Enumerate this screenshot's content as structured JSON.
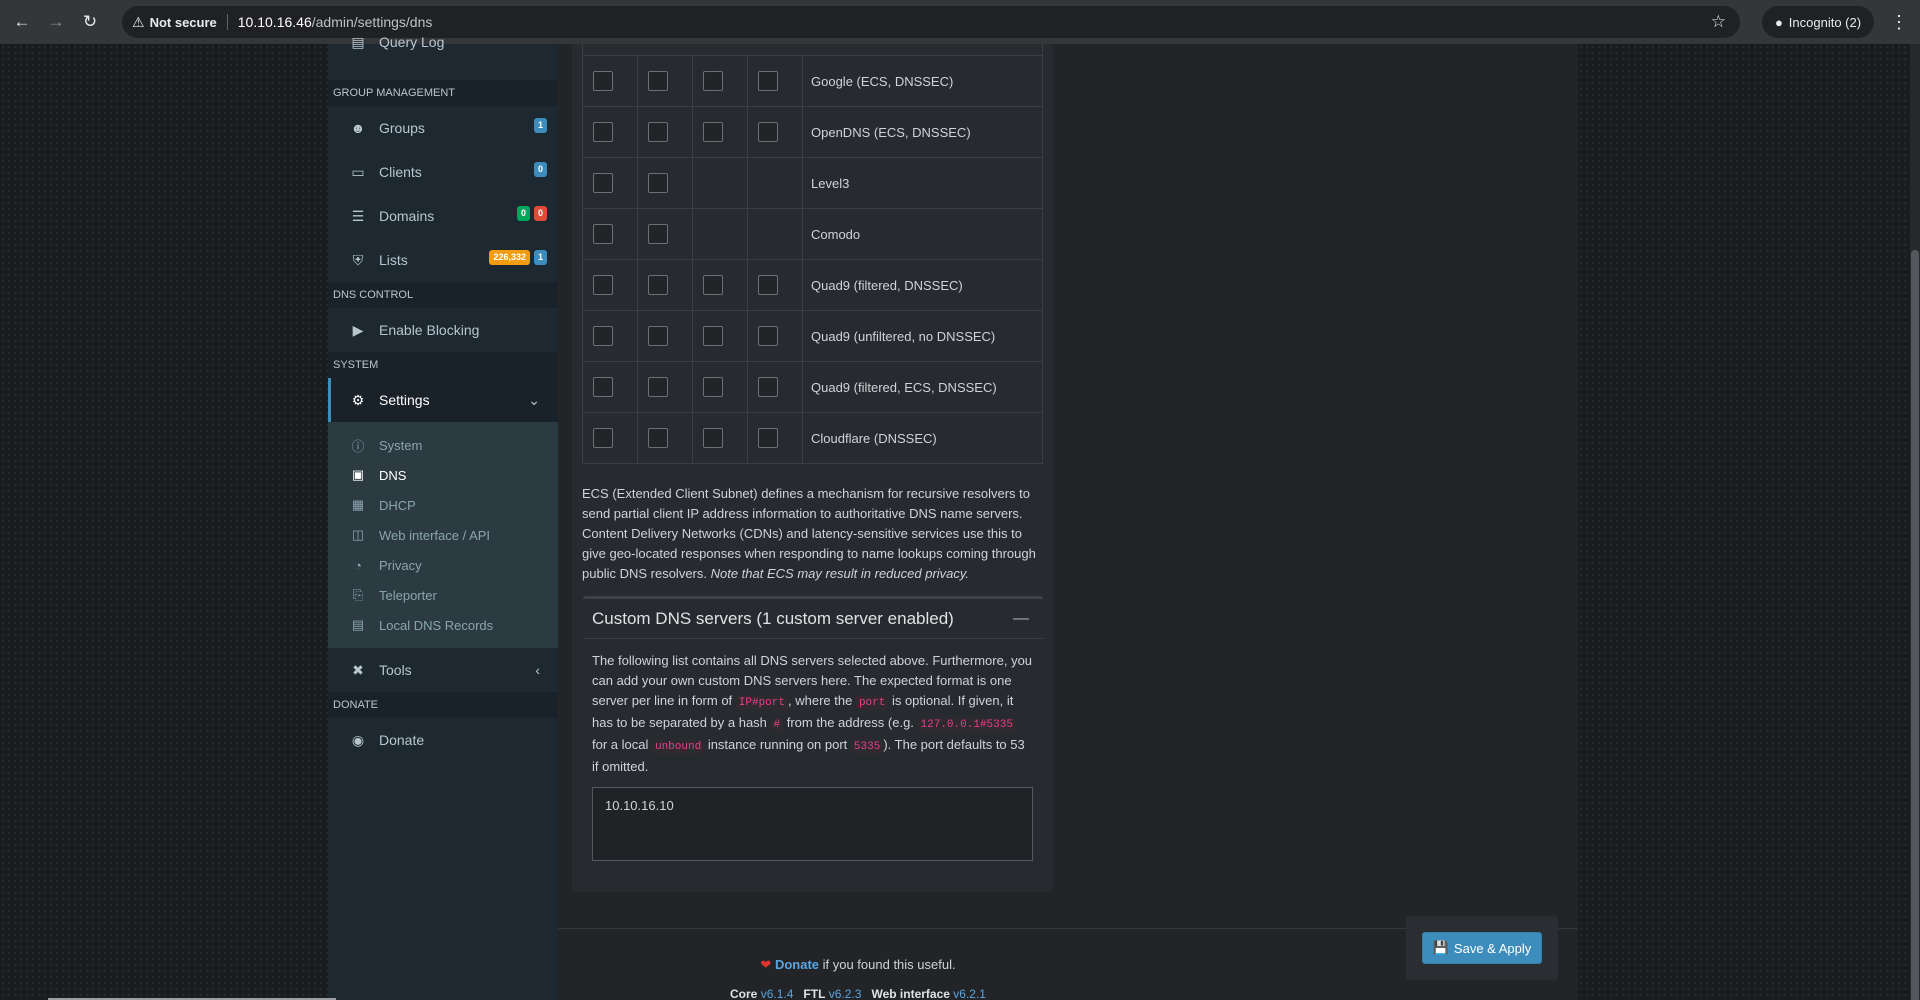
{
  "browser": {
    "not_secure": "Not secure",
    "url_host": "10.10.16.46",
    "url_path": "/admin/settings/dns",
    "incognito": "Incognito (2)"
  },
  "sidebar": {
    "top_item": "Query Log",
    "group_header": "GROUP MANAGEMENT",
    "groups": {
      "label": "Groups",
      "badge": "1"
    },
    "clients": {
      "label": "Clients",
      "badge": "0"
    },
    "domains": {
      "label": "Domains",
      "badge_green": "0",
      "badge_red": "0"
    },
    "lists": {
      "label": "Lists",
      "badge_orange": "226,332",
      "badge_blue": "1"
    },
    "dns_header": "DNS CONTROL",
    "enable_blocking": "Enable Blocking",
    "system_header": "SYSTEM",
    "settings": "Settings",
    "sub": [
      "System",
      "DNS",
      "DHCP",
      "Web interface / API",
      "Privacy",
      "Teleporter",
      "Local DNS Records"
    ],
    "tools": "Tools",
    "donate_header": "DONATE",
    "donate": "Donate"
  },
  "dns_servers": [
    {
      "name": "Google (ECS, DNSSEC)",
      "checkboxes": 4
    },
    {
      "name": "OpenDNS (ECS, DNSSEC)",
      "checkboxes": 4
    },
    {
      "name": "Level3",
      "checkboxes": 2
    },
    {
      "name": "Comodo",
      "checkboxes": 2
    },
    {
      "name": "Quad9 (filtered, DNSSEC)",
      "checkboxes": 4
    },
    {
      "name": "Quad9 (unfiltered, no DNSSEC)",
      "checkboxes": 4
    },
    {
      "name": "Quad9 (filtered, ECS, DNSSEC)",
      "checkboxes": 4
    },
    {
      "name": "Cloudflare (DNSSEC)",
      "checkboxes": 4
    }
  ],
  "ecs": {
    "text": "ECS (Extended Client Subnet) defines a mechanism for recursive resolvers to send partial client IP address information to authoritative DNS name servers. Content Delivery Networks (CDNs) and latency-sensitive services use this to give geo-located responses when responding to name lookups coming through public DNS resolvers. ",
    "note": "Note that ECS may result in reduced privacy."
  },
  "custom": {
    "title": "Custom DNS servers (1 custom server enabled)",
    "t1": "The following list contains all DNS servers selected above. Furthermore, you can add your own custom DNS servers here. The expected format is one server per line in form of ",
    "c1": "IP#port",
    "t2": ", where the ",
    "c2": "port",
    "t3": " is optional. If given, it has to be separated by a hash ",
    "c3": "#",
    "t4": " from the address (e.g. ",
    "c4": "127.0.0.1#5335",
    "t5": " for a local ",
    "c5": "unbound",
    "t6": " instance running on port ",
    "c6": "5335",
    "t7": "). The port defaults to 53 if omitted.",
    "value": "10.10.16.10"
  },
  "footer": {
    "donate": "Donate",
    "donate_suffix": " if you found this useful.",
    "core_label": "Core",
    "core_ver": "v6.1.4",
    "ftl_label": "FTL",
    "ftl_ver": "v6.2.3",
    "web_label": "Web interface",
    "web_ver": "v6.2.1",
    "save": "Save & Apply"
  }
}
